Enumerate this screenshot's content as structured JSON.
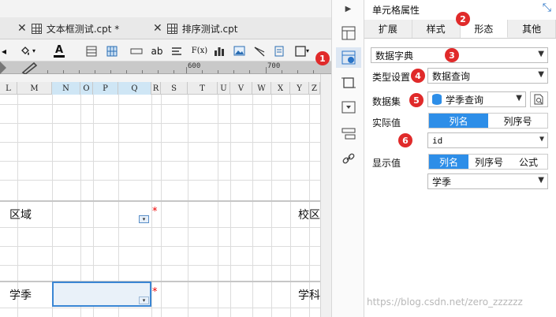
{
  "tabs": [
    {
      "label": "文本框测试.cpt *"
    },
    {
      "label": "排序测试.cpt"
    }
  ],
  "toolbar": {
    "text_tool": "ab",
    "formula_tool": "F(x)"
  },
  "ruler": {
    "marks": [
      "600",
      "700"
    ]
  },
  "columns": [
    "L",
    "M",
    "N",
    "O",
    "P",
    "Q",
    "R",
    "S",
    "T",
    "U",
    "V",
    "W",
    "X",
    "Y",
    "Z"
  ],
  "cells": {
    "area_label": "区域",
    "campus_label": "校区",
    "term_label": "学季",
    "subject_label": "学科",
    "required_mark": "*"
  },
  "panel": {
    "title": "单元格属性",
    "tabs": [
      "扩展",
      "样式",
      "形态",
      "其他"
    ],
    "active_tab": "形态",
    "widget_type": "数据字典",
    "type_label": "类型设置",
    "type_value": "数据查询",
    "dataset_label": "数据集",
    "dataset_value": "学季查询",
    "actual_label": "实际值",
    "actual_options": [
      "列名",
      "列序号"
    ],
    "actual_field": "id",
    "display_label": "显示值",
    "display_options": [
      "列名",
      "列序号",
      "公式"
    ],
    "display_field": "学季"
  },
  "badges": [
    "1",
    "2",
    "3",
    "4",
    "5",
    "6"
  ],
  "watermark": "https://blog.csdn.net/zero_zzzzzz",
  "colors": {
    "accent": "#2d8ee8",
    "badge": "#e02a2a",
    "selection": "#3a86d4"
  }
}
